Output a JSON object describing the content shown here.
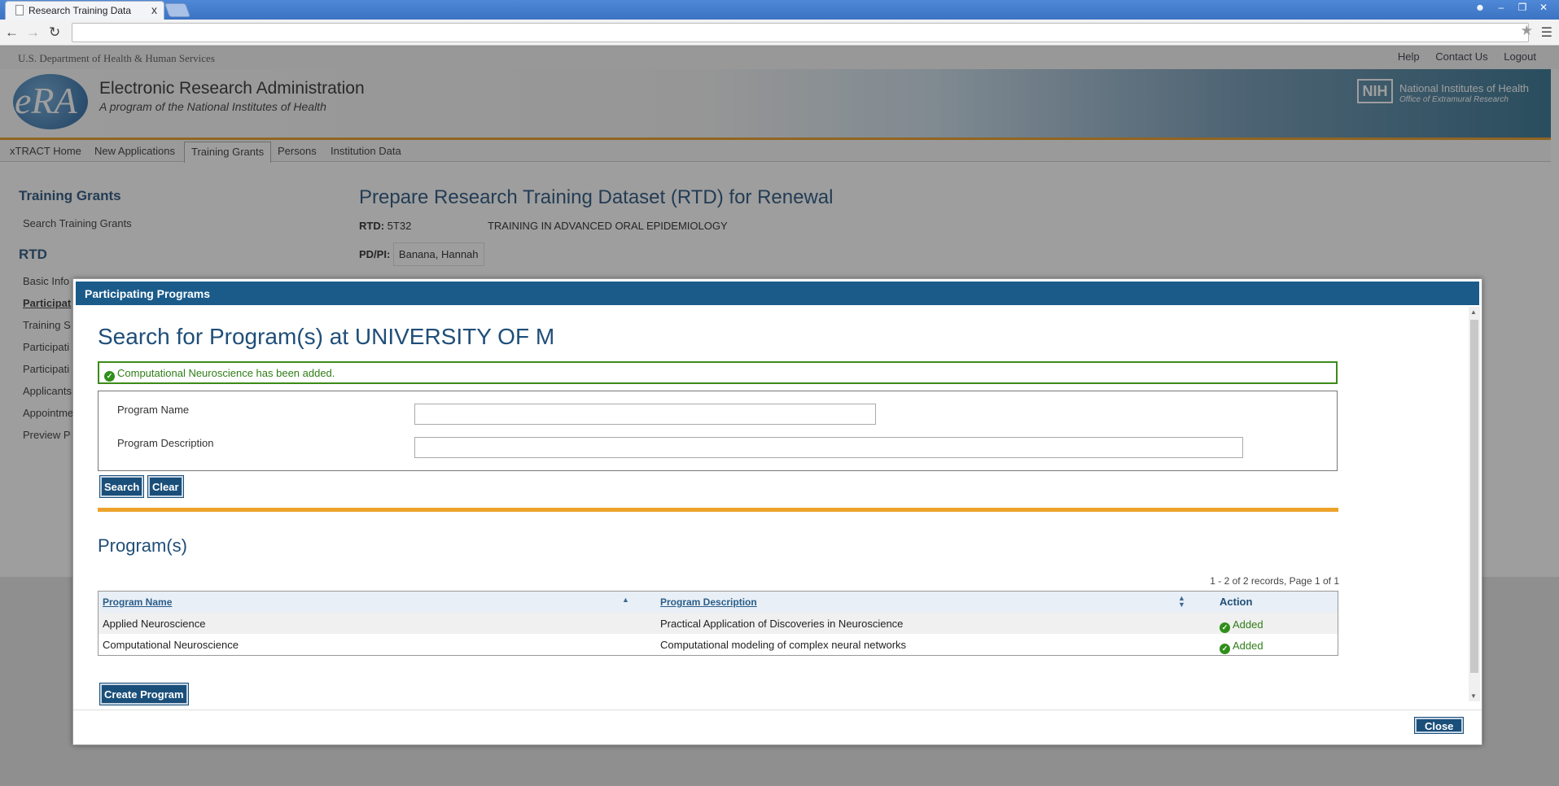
{
  "browser": {
    "tab_title": "Research Training Data",
    "tab_close": "x",
    "address": ""
  },
  "page": {
    "hhs_text": "U.S. Department of Health & Human Services",
    "top_links": [
      "Help",
      "Contact Us",
      "Logout"
    ],
    "logo_text": "eRA",
    "app_title": "Electronic Research Administration",
    "app_subtitle": "A program of the National Institutes of Health",
    "nih_box": "NIH",
    "nih_line1": "National Institutes of Health",
    "nih_line2": "Office of Extramural Research",
    "nav": [
      "xTRACT Home",
      "New Applications",
      "Training Grants",
      "Persons",
      "Institution Data"
    ],
    "side_heading_1": "Training Grants",
    "side_link_search": "Search Training Grants",
    "side_heading_2": "RTD",
    "side_items": [
      "Basic Info",
      "Participat",
      "Training S",
      "Participati",
      "Participati",
      "Applicants",
      "Appointme",
      "Preview P"
    ],
    "title": "Prepare Research Training Dataset (RTD) for Renewal",
    "rtd_label": "RTD:",
    "rtd_value": "5T32",
    "rtd_desc": "TRAINING IN ADVANCED ORAL EPIDEMIOLOGY",
    "pdpi_label": "PD/PI:",
    "pdpi_value": "Banana, Hannah"
  },
  "modal": {
    "header": "Participating Programs",
    "heading": "Search for Program(s) at UNIVERSITY OF M",
    "success_message": "Computational Neuroscience has been added.",
    "program_name_label": "Program Name",
    "program_name_value": "",
    "program_desc_label": "Program Description",
    "program_desc_value": "",
    "search_button": "Search",
    "clear_button": "Clear",
    "programs_heading": "Program(s)",
    "records_text": "1 - 2 of 2 records, Page 1 of 1",
    "columns": [
      "Program Name",
      "Program Description",
      "Action"
    ],
    "rows": [
      {
        "name": "Applied Neuroscience",
        "description": "Practical Application of Discoveries in Neuroscience",
        "action": "Added"
      },
      {
        "name": "Computational Neuroscience",
        "description": "Computational modeling of complex neural networks",
        "action": "Added"
      }
    ],
    "create_button": "Create Program",
    "close_button": "Close"
  },
  "colors": {
    "header_blue": "#1a5b8a",
    "accent_orange": "#eda32b",
    "success_green": "#2f7d17"
  }
}
